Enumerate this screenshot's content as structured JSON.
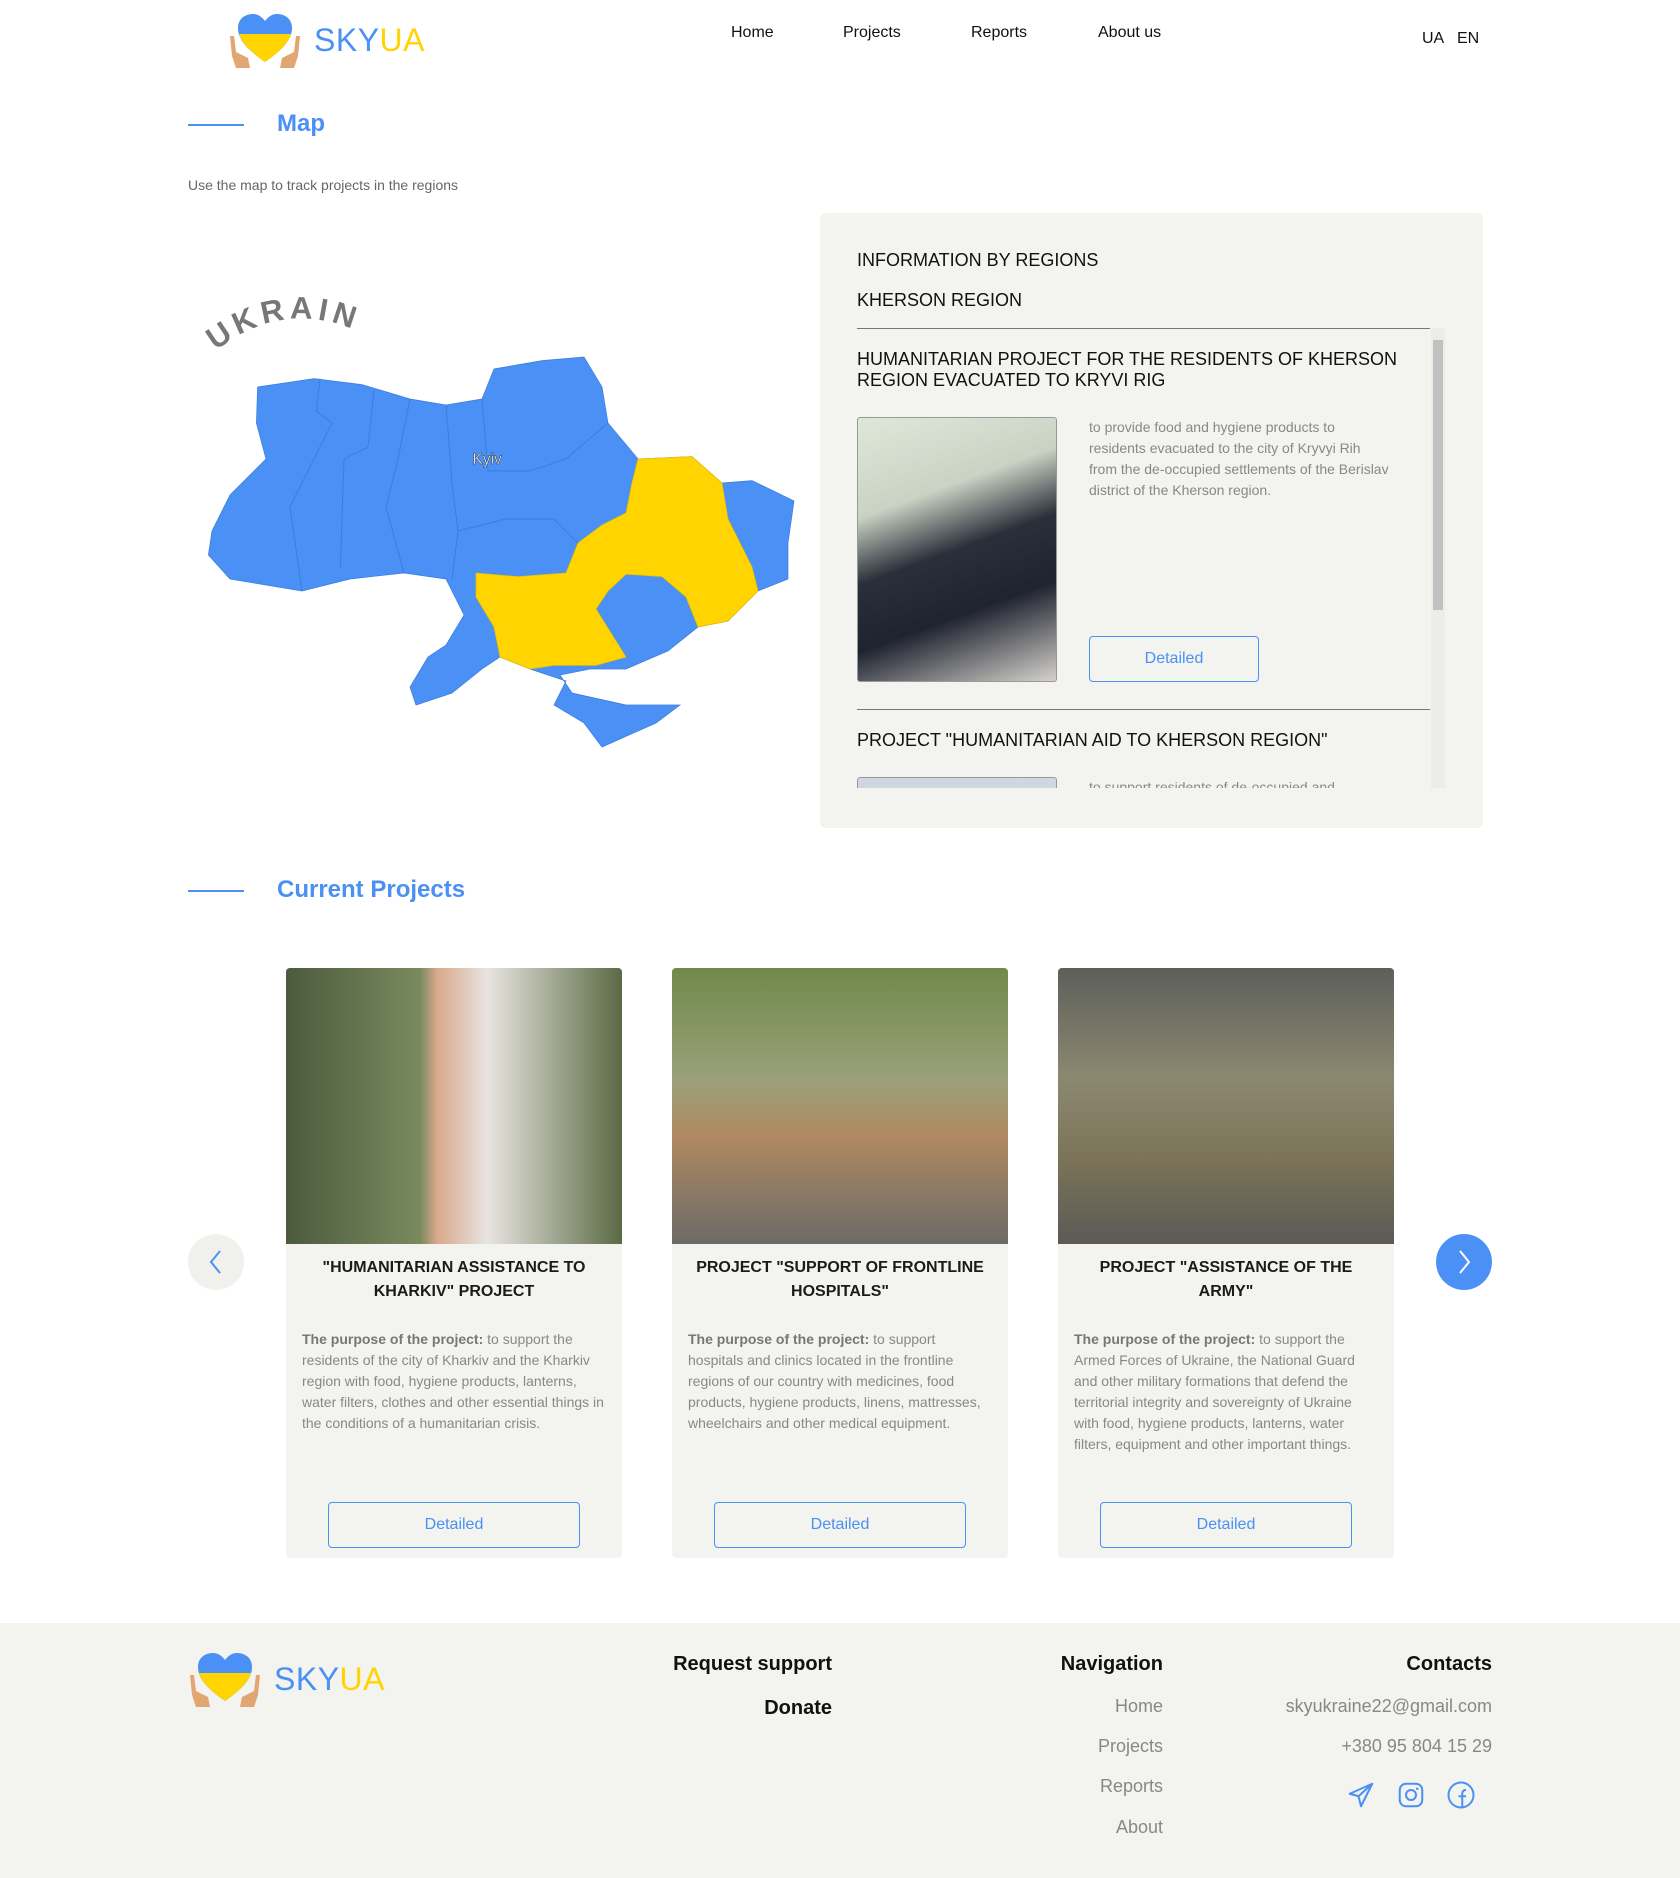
{
  "brand": {
    "sky": "SKY",
    "ua": "UA"
  },
  "nav": [
    "Home",
    "Projects",
    "Reports",
    "About us"
  ],
  "lang": [
    "UA",
    "EN"
  ],
  "map_section": {
    "title": "Map",
    "subtitle": "Use the map to track projects in the regions",
    "map_label": "UKRAINE",
    "city": "Kyiv"
  },
  "info_panel": {
    "heading": "INFORMATION BY REGIONS",
    "region": "KHERSON REGION",
    "projects": [
      {
        "title": "HUMANITARIAN PROJECT FOR THE RESIDENTS OF KHERSON REGION EVACUATED TO KRYVI RIG",
        "description": "to provide food and hygiene products to residents evacuated to the city of Kryvyi Rih from the de-occupied settlements of the Berislav district of the Kherson region.",
        "button": "Detailed"
      },
      {
        "title": "PROJECT \"HUMANITARIAN AID TO KHERSON REGION\"",
        "description": "to support residents of de-occupied and"
      }
    ]
  },
  "current": {
    "title": "Current Projects",
    "purpose_label": "The purpose of the project:",
    "cards": [
      {
        "title": "\"HUMANITARIAN ASSISTANCE TO KHARKIV\" PROJECT",
        "description": " to support the residents of the city of Kharkiv and the Kharkiv region with food, hygiene products, lanterns, water filters, clothes and other essential things in the conditions of a humanitarian crisis.",
        "button": "Detailed"
      },
      {
        "title": "PROJECT \"SUPPORT OF FRONTLINE HOSPITALS\"",
        "description": " to support hospitals and clinics located in the frontline regions of our country with medicines, food products, hygiene products, linens, mattresses, wheelchairs and other medical equipment.",
        "button": "Detailed"
      },
      {
        "title": "PROJECT \"ASSISTANCE OF THE ARMY\"",
        "description": " to support the Armed Forces of Ukraine, the National Guard and other military formations that defend the territorial integrity and sovereignty of Ukraine with food, hygiene products, lanterns, water filters, equipment and other important things.",
        "button": "Detailed"
      }
    ]
  },
  "footer": {
    "request_support": "Request support",
    "donate": "Donate",
    "navigation_title": "Navigation",
    "navigation": [
      "Home",
      "Projects",
      "Reports",
      "About"
    ],
    "contacts_title": "Contacts",
    "email": "skyukraine22@gmail.com",
    "phone": "+380 95 804 15 29",
    "social": [
      "telegram-icon",
      "instagram-icon",
      "facebook-icon"
    ]
  },
  "colors": {
    "accent": "#4a90f5",
    "yellow": "#ffd400",
    "panel": "#f3f3ef"
  }
}
